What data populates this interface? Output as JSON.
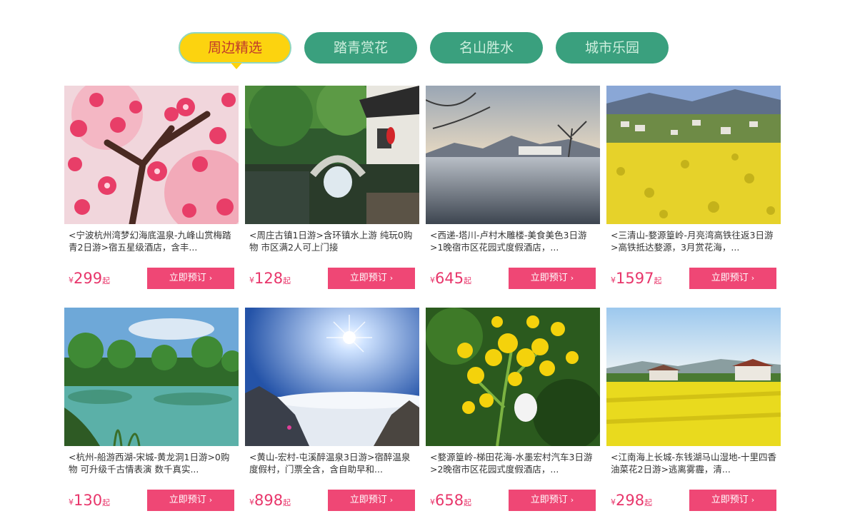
{
  "tabs": [
    {
      "label": "周边精选",
      "active": true
    },
    {
      "label": "踏青赏花",
      "active": false
    },
    {
      "label": "名山胜水",
      "active": false
    },
    {
      "label": "城市乐园",
      "active": false
    }
  ],
  "colors": {
    "tab": "#3aa07e",
    "tab_active": "#fcd30f",
    "price": "#e8366b",
    "button": "#ef4775"
  },
  "currency": "¥",
  "price_suffix": "起",
  "book_label": "立即预订",
  "book_icon": "chevron-right-icon",
  "products": [
    {
      "desc": "<宁波杭州湾梦幻海底温泉-九峰山赏梅踏青2日游>宿五星级酒店，含丰...",
      "price": "299",
      "image": "plum-blossom"
    },
    {
      "desc": "<周庄古镇1日游>含环镇水上游 纯玩0购物 市区满2人可上门接",
      "price": "128",
      "image": "water-town-bridge"
    },
    {
      "desc": "<西递-塔川-卢村木雕楼-美食美色3日游>1晚宿市区花园式度假酒店，...",
      "price": "645",
      "image": "lake-village-sunset"
    },
    {
      "desc": "<三清山-婺源篁岭-月亮湾高铁往返3日游>高铁抵达婺源，3月赏花海，...",
      "price": "1597",
      "image": "rapeseed-village"
    },
    {
      "desc": "<杭州-船游西湖-宋城-黄龙洞1日游>0购物 可升级千古情表演 数千真实...",
      "price": "130",
      "image": "west-lake"
    },
    {
      "desc": "<黄山-宏村-屯溪醉温泉3日游>宿醉温泉度假村，门票全含，含自助早和...",
      "price": "898",
      "image": "mountain-sea-of-clouds"
    },
    {
      "desc": "<婺源篁岭-梯田花海-水墨宏村汽车3日游>2晚宿市区花园式度假酒店，...",
      "price": "658",
      "image": "rapeseed-flowers-closeup"
    },
    {
      "desc": "<江南海上长城-东钱湖马山湿地-十里四香油菜花2日游>逃离雾霾，清...",
      "price": "298",
      "image": "rapeseed-field-houses"
    }
  ]
}
